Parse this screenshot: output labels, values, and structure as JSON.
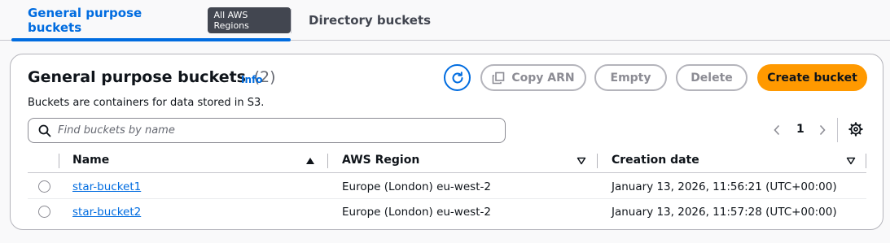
{
  "tabs": {
    "general": {
      "label": "General purpose buckets",
      "badge": "All AWS Regions"
    },
    "directory": {
      "label": "Directory buckets"
    }
  },
  "header": {
    "title": "General purpose buckets",
    "count": "(2)",
    "info": "Info",
    "description": "Buckets are containers for data stored in S3."
  },
  "actions": {
    "refresh_icon": "refresh-icon",
    "copy_arn": "Copy ARN",
    "empty": "Empty",
    "delete": "Delete",
    "create": "Create bucket"
  },
  "search": {
    "placeholder": "Find buckets by name",
    "value": ""
  },
  "pagination": {
    "current_page": "1"
  },
  "table": {
    "columns": [
      "Name",
      "AWS Region",
      "Creation date"
    ],
    "rows": [
      {
        "name": "star-bucket1",
        "region": "Europe (London) eu-west-2",
        "created": "January 13, 2026, 11:56:21 (UTC+00:00)"
      },
      {
        "name": "star-bucket2",
        "region": "Europe (London) eu-west-2",
        "created": "January 13, 2026, 11:57:28 (UTC+00:00)"
      }
    ]
  },
  "colors": {
    "accent": "#006ce0",
    "primary_button": "#ff9900",
    "badge_bg": "#424650"
  }
}
